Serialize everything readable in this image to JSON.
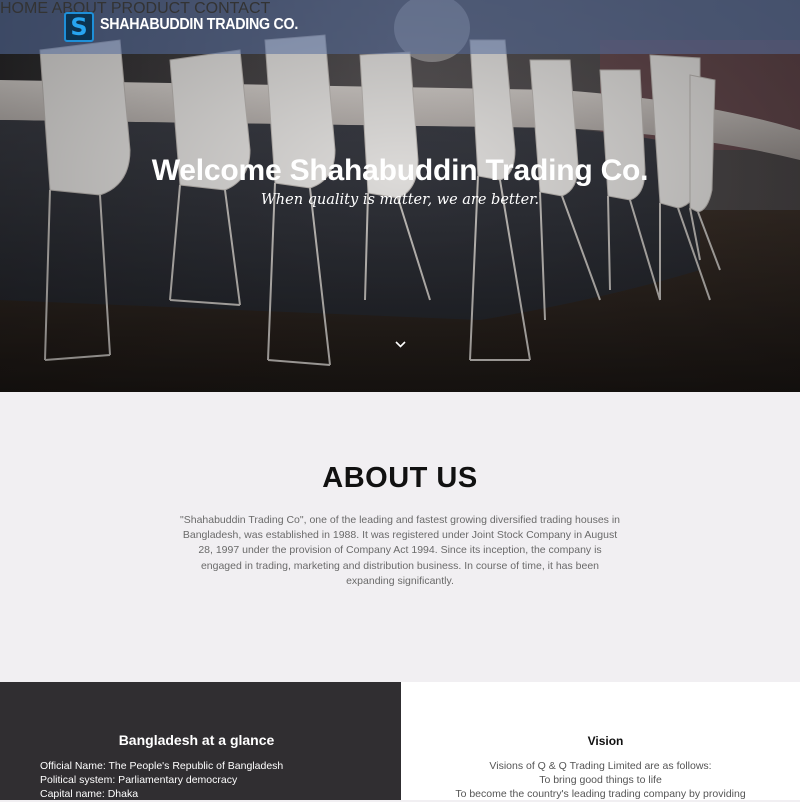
{
  "header": {
    "logo_letter": "S",
    "brand": "SHAHABUDDIN TRADING CO.",
    "nav": [
      {
        "label": "HOME"
      },
      {
        "label": "ABOUT"
      },
      {
        "label": "PRODUCT"
      },
      {
        "label": "CONTACT"
      }
    ]
  },
  "hero": {
    "title": "Welcome Shahabuddin Trading Co.",
    "subtitle": "When quality is matter, we are better."
  },
  "about": {
    "heading": "ABOUT US",
    "body": "\"Shahabuddin Trading Co\", one of the leading and fastest growing diversified trading houses in Bangladesh, was established in 1988. It was registered under Joint Stock Company in August 28, 1997 under the provision of Company Act 1994. Since its inception, the company is engaged in trading, marketing and distribution business. In course of time, it has been expanding significantly."
  },
  "glance": {
    "heading": "Bangladesh at a glance",
    "items": [
      "Official Name: The People's Republic of Bangladesh",
      "Political system: Parliamentary democracy",
      "Capital name: Dhaka"
    ]
  },
  "vision": {
    "heading": "Vision",
    "lines": [
      "Visions of Q & Q Trading Limited are as follows:",
      "To bring good things to life",
      "To become the country's leading trading company by providing"
    ]
  },
  "colors": {
    "navbar": "#566e9e",
    "logo_accent": "#27a5f0",
    "about_bg": "#f1eff2",
    "glance_bg": "#302e31"
  },
  "icons": {
    "logo": "s-logo-icon",
    "scroll": "chevron-down-icon"
  }
}
